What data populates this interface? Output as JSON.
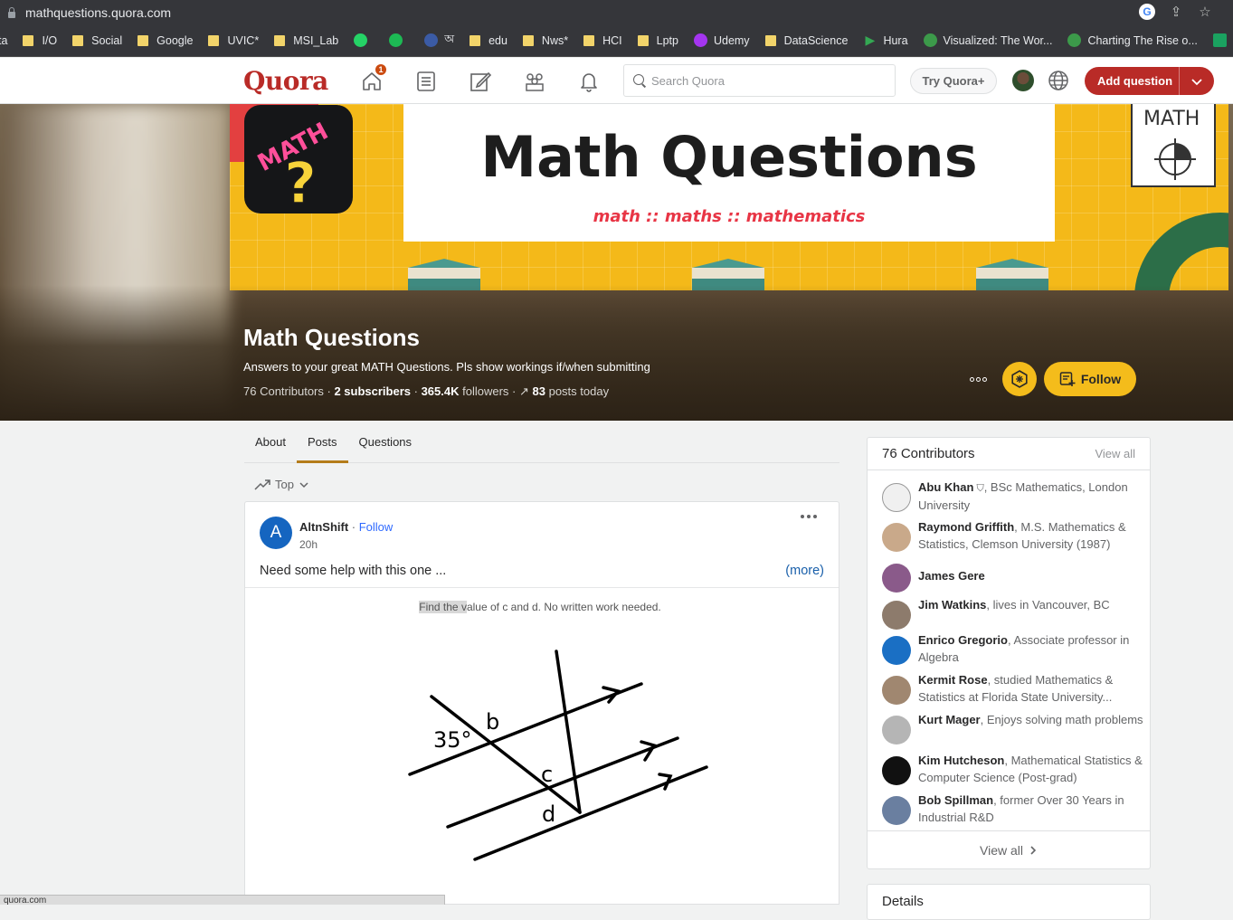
{
  "browser": {
    "url": "mathquestions.quora.com",
    "bookmarks": [
      {
        "label": "ta",
        "kind": "text"
      },
      {
        "label": "I/O",
        "kind": "folder"
      },
      {
        "label": "Social",
        "kind": "folder"
      },
      {
        "label": "Google",
        "kind": "folder"
      },
      {
        "label": "UVIC*",
        "kind": "folder"
      },
      {
        "label": "MSI_Lab",
        "kind": "folder"
      },
      {
        "label": "",
        "kind": "whatsapp"
      },
      {
        "label": "",
        "kind": "spotify"
      },
      {
        "label": "অ",
        "kind": "bangla"
      },
      {
        "label": "edu",
        "kind": "folder"
      },
      {
        "label": "Nws*",
        "kind": "folder"
      },
      {
        "label": "HCI",
        "kind": "folder"
      },
      {
        "label": "Lptp",
        "kind": "folder"
      },
      {
        "label": "Udemy",
        "kind": "udemy"
      },
      {
        "label": "DataScience",
        "kind": "folder"
      },
      {
        "label": "Hura",
        "kind": "play"
      },
      {
        "label": "Visualized: The Wor...",
        "kind": "vc"
      },
      {
        "label": "Charting The Rise o...",
        "kind": "vc"
      },
      {
        "label": "RSVP",
        "kind": "sheet"
      }
    ]
  },
  "header": {
    "logo": "Quora",
    "notification_count": "1",
    "search_placeholder": "Search Quora",
    "try_plus": "Try Quora+",
    "add_question": "Add question"
  },
  "space": {
    "banner_title": "Math Questions",
    "banner_subtitle": "math :: maths :: mathematics",
    "banner_card_text": "MATH",
    "logo_text": "MATH",
    "name": "Math Questions",
    "description": "Answers to your great MATH Questions. Pls show workings if/when submitting",
    "stats": {
      "contributors": "76 Contributors",
      "subscribers": "2 subscribers",
      "followers_count": "365.4K",
      "followers_label": "followers",
      "posts_count": "83",
      "posts_label": "posts today"
    },
    "follow_label": "Follow"
  },
  "tabs": [
    "About",
    "Posts",
    "Questions"
  ],
  "active_tab": "Posts",
  "sort": {
    "label": "Top"
  },
  "post": {
    "avatar_letter": "A",
    "author": "AltnShift",
    "follow": "Follow",
    "time": "20h",
    "text": "Need some help with this one ...",
    "more": "(more)",
    "caption_highlight": "Find the v",
    "caption_rest": "alue of c and d.  No written work needed.",
    "diagram_labels": {
      "angle": "35°",
      "b": "b",
      "c": "c",
      "d": "d"
    }
  },
  "status_bar": "quora.com",
  "sidebar": {
    "title": "76 Contributors",
    "view_all_top": "View all",
    "view_all_bottom": "View all",
    "contributors": [
      {
        "name": "Abu Khan",
        "credential": ", BSc Mathematics, London University",
        "verified": true,
        "avatar_color": "#f0f0f0"
      },
      {
        "name": "Raymond Griffith",
        "credential": ", M.S. Mathematics & Statistics, Clemson University (1987)",
        "verified": false,
        "avatar_color": "#c9a98a"
      },
      {
        "name": "James Gere",
        "credential": "",
        "verified": false,
        "avatar_color": "#8a5a8a"
      },
      {
        "name": "Jim Watkins",
        "credential": ", lives in Vancouver, BC",
        "verified": false,
        "avatar_color": "#8d7b6c"
      },
      {
        "name": "Enrico Gregorio",
        "credential": ", Associate professor in Algebra",
        "verified": false,
        "avatar_color": "#1a6fc4"
      },
      {
        "name": "Kermit Rose",
        "credential": ", studied Mathematics & Statistics at Florida State University...",
        "verified": false,
        "avatar_color": "#a08770"
      },
      {
        "name": "Kurt Mager",
        "credential": ", Enjoys solving math problems",
        "verified": false,
        "avatar_color": "#b5b5b5"
      },
      {
        "name": "Kim Hutcheson",
        "credential": ", Mathematical Statistics & Computer Science (Post-grad)",
        "verified": false,
        "avatar_color": "#111111"
      },
      {
        "name": "Bob Spillman",
        "credential": ", former Over 30 Years in Industrial R&D",
        "verified": false,
        "avatar_color": "#6a7fa0"
      }
    ],
    "details_title": "Details"
  }
}
